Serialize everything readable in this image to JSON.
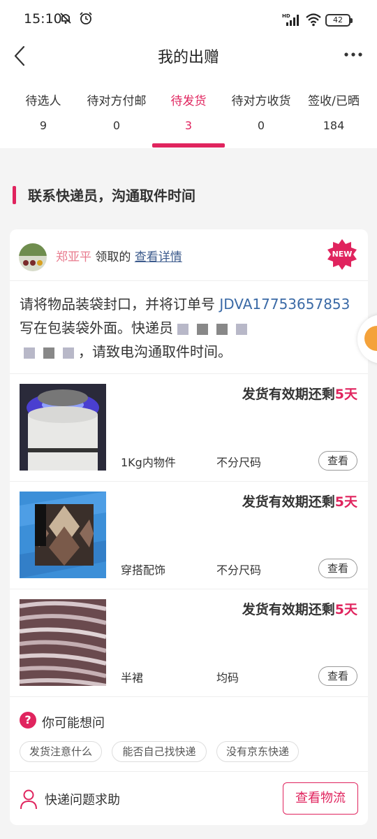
{
  "status_bar": {
    "time": "15:10",
    "battery": "42",
    "icons": [
      "mute-icon",
      "alarm-icon",
      "hd-signal-icon",
      "wifi-icon",
      "battery-icon"
    ]
  },
  "header": {
    "title": "我的出赠",
    "back_icon": "chevron-left-icon",
    "more_icon": "more-dots-icon"
  },
  "tabs": [
    {
      "label": "待选人",
      "count": "9",
      "active": false
    },
    {
      "label": "待对方付邮",
      "count": "0",
      "active": false
    },
    {
      "label": "待发货",
      "count": "3",
      "active": true
    },
    {
      "label": "待对方收货",
      "count": "0",
      "active": false
    },
    {
      "label": "签收/已晒",
      "count": "184",
      "active": false
    }
  ],
  "section": {
    "title": "联系快递员，沟通取件时间"
  },
  "order": {
    "claimer_name": "郑亚平",
    "claim_text": "领取的",
    "detail_link": "查看详情",
    "badge": "NEW",
    "notice_part1": "请将物品装袋封口，并将订单号 ",
    "order_number": "JDVA17753657853",
    "notice_part2": " 写在包装袋外面。快递员",
    "notice_part3": "，请致电沟通取件时间。"
  },
  "items": [
    {
      "deadline_prefix": "发货有效期还剩",
      "deadline_days": "5天",
      "category": "1Kg内物件",
      "size": "不分尺码",
      "view_label": "查看",
      "thumb": "mosquito-lamp"
    },
    {
      "deadline_prefix": "发货有效期还剩",
      "deadline_days": "5天",
      "category": "穿搭配饰",
      "size": "不分尺码",
      "view_label": "查看",
      "thumb": "argyle-socks"
    },
    {
      "deadline_prefix": "发货有效期还剩",
      "deadline_days": "5天",
      "category": "半裙",
      "size": "均码",
      "view_label": "查看",
      "thumb": "pleated-skirt"
    }
  ],
  "faq": {
    "title": "你可能想问",
    "icon": "question-icon",
    "chips": [
      "发货注意什么",
      "能否自己找快递",
      "没有京东快递"
    ]
  },
  "help": {
    "label": "快递问题求助",
    "icon": "person-icon",
    "button": "查看物流"
  },
  "colors": {
    "accent": "#e0245e",
    "link": "#3b5a8c",
    "order_number": "#3b6aa6",
    "claimer_name": "#e87a8d"
  }
}
